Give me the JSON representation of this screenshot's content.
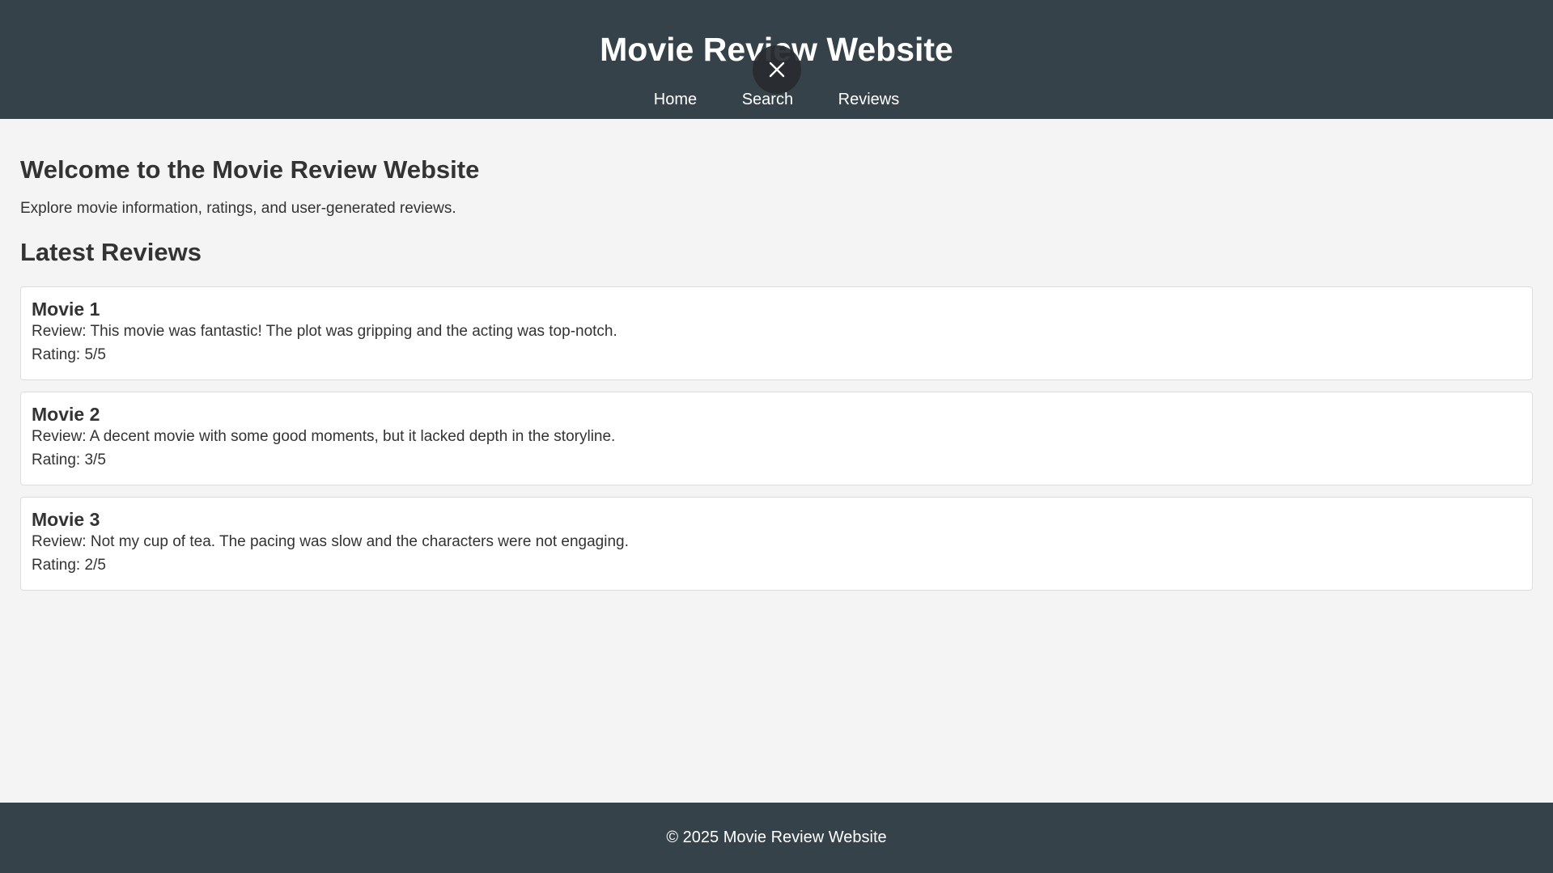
{
  "header": {
    "title": "Movie Review Website",
    "nav": [
      {
        "label": "Home"
      },
      {
        "label": "Search"
      },
      {
        "label": "Reviews"
      }
    ]
  },
  "overlay": {
    "icon": "close-icon"
  },
  "main": {
    "welcome_heading": "Welcome to the Movie Review Website",
    "welcome_text": "Explore movie information, ratings, and user-generated reviews.",
    "latest_heading": "Latest Reviews",
    "reviews": [
      {
        "title": "Movie 1",
        "review": "Review: This movie was fantastic! The plot was gripping and the acting was top-notch.",
        "rating": "Rating: 5/5"
      },
      {
        "title": "Movie 2",
        "review": "Review: A decent movie with some good moments, but it lacked depth in the storyline.",
        "rating": "Rating: 3/5"
      },
      {
        "title": "Movie 3",
        "review": "Review: Not my cup of tea. The pacing was slow and the characters were not engaging.",
        "rating": "Rating: 2/5"
      }
    ]
  },
  "footer": {
    "text": "© 2025 Movie Review Website"
  },
  "colors": {
    "header_bg": "#36424a",
    "page_bg": "#f4f4f4",
    "card_bg": "#ffffff",
    "text": "#333333"
  }
}
